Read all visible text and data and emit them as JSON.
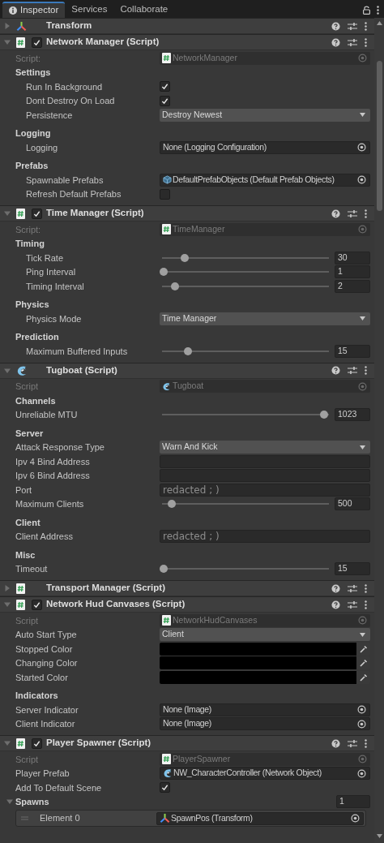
{
  "tabs": [
    {
      "label": "Inspector",
      "selected": true
    },
    {
      "label": "Services",
      "selected": false
    },
    {
      "label": "Collaborate",
      "selected": false
    }
  ],
  "components": [
    {
      "kind": "transform",
      "title": "Transform",
      "expanded": false
    },
    {
      "kind": "script",
      "title": "Network Manager (Script)",
      "expanded": true,
      "enabled": true,
      "rows": [
        {
          "kind": "script",
          "label": "Script:",
          "value": "NetworkManager"
        },
        {
          "kind": "header",
          "label": "Settings",
          "children": [
            {
              "kind": "checkbox",
              "label": "Run In Background",
              "checked": true
            },
            {
              "kind": "checkbox",
              "label": "Dont Destroy On Load",
              "checked": true
            },
            {
              "kind": "dropdown",
              "label": "Persistence",
              "value": "Destroy Newest"
            }
          ]
        },
        {
          "kind": "header",
          "label": "Logging",
          "children": [
            {
              "kind": "object",
              "label": "Logging",
              "value": "None (Logging Configuration)"
            }
          ]
        },
        {
          "kind": "header",
          "label": "Prefabs",
          "children": [
            {
              "kind": "prefab_object",
              "label": "Spawnable Prefabs",
              "value": "DefaultPrefabObjects (Default Prefab Objects)"
            },
            {
              "kind": "checkbox",
              "label": "Refresh Default Prefabs",
              "checked": false
            }
          ]
        }
      ]
    },
    {
      "kind": "script",
      "title": "Time Manager (Script)",
      "expanded": true,
      "enabled": true,
      "rows": [
        {
          "kind": "script",
          "label": "Script:",
          "value": "TimeManager"
        },
        {
          "kind": "header",
          "label": "Timing",
          "children": [
            {
              "kind": "slider",
              "label": "Tick Rate",
              "level": 0.13,
              "value": "30"
            },
            {
              "kind": "slider",
              "label": "Ping Interval",
              "level": 0.0,
              "value": "1"
            },
            {
              "kind": "slider",
              "label": "Timing Interval",
              "level": 0.07,
              "value": "2"
            }
          ]
        },
        {
          "kind": "header",
          "label": "Physics",
          "children": [
            {
              "kind": "dropdown",
              "label": "Physics Mode",
              "value": "Time Manager"
            }
          ]
        },
        {
          "kind": "header",
          "label": "Prediction",
          "children": [
            {
              "kind": "slider",
              "label": "Maximum Buffered Inputs",
              "level": 0.15,
              "value": "15"
            }
          ]
        }
      ]
    },
    {
      "kind": "tugboat",
      "title": "Tugboat (Script)",
      "expanded": true,
      "rows": [
        {
          "kind": "script",
          "label": "Script",
          "value": "Tugboat"
        },
        {
          "kind": "header",
          "label": "Channels"
        },
        {
          "kind": "slider",
          "label": "Unreliable MTU",
          "level": 0.98,
          "value": "1023"
        },
        {
          "kind": "header",
          "label": "Server"
        },
        {
          "kind": "dropdown",
          "label": "Attack Response Type",
          "value": "Warn And Kick"
        },
        {
          "kind": "text",
          "label": "Ipv 4 Bind Address"
        },
        {
          "kind": "text",
          "label": "Ipv 6 Bind Address"
        },
        {
          "kind": "text",
          "label": "Port",
          "value": "redacted ; )"
        },
        {
          "kind": "slider",
          "label": "Maximum Clients",
          "level": 0.05,
          "value": "500"
        },
        {
          "kind": "header",
          "label": "Client"
        },
        {
          "kind": "text",
          "label": "Client Address",
          "value": "redacted ; )"
        },
        {
          "kind": "header",
          "label": "Misc"
        },
        {
          "kind": "slider",
          "label": "Timeout",
          "level": 0.0,
          "value": "15"
        }
      ]
    },
    {
      "kind": "script",
      "title": "Transport Manager (Script)",
      "expanded": false
    },
    {
      "kind": "script",
      "title": "Network Hud Canvases (Script)",
      "expanded": true,
      "enabled": true,
      "rows": [
        {
          "kind": "script",
          "label": "Script",
          "value": "NetworkHudCanvases"
        },
        {
          "kind": "dropdown",
          "label": "Auto Start Type",
          "value": "Client"
        },
        {
          "kind": "color",
          "label": "Stopped Color",
          "color": "#000000"
        },
        {
          "kind": "color",
          "label": "Changing Color",
          "color": "#000000"
        },
        {
          "kind": "color",
          "label": "Started Color",
          "color": "#000000"
        },
        {
          "kind": "header",
          "label": "Indicators"
        },
        {
          "kind": "object",
          "label": "Server Indicator",
          "value": "None (Image)"
        },
        {
          "kind": "object",
          "label": "Client Indicator",
          "value": "None (Image)"
        }
      ]
    },
    {
      "kind": "script",
      "title": "Player Spawner (Script)",
      "expanded": true,
      "enabled": true,
      "rows": [
        {
          "kind": "script",
          "label": "Script",
          "value": "PlayerSpawner"
        },
        {
          "kind": "network_object",
          "label": "Player Prefab",
          "value": "NW_CharacterController (Network Object)"
        },
        {
          "kind": "checkbox",
          "label": "Add To Default Scene",
          "checked": true
        },
        {
          "kind": "array",
          "label": "Spawns",
          "count": "1",
          "expanded": true,
          "children": [
            {
              "kind": "element",
              "label": "Element 0",
              "value": "SpawnPos (Transform)"
            }
          ]
        }
      ]
    }
  ]
}
